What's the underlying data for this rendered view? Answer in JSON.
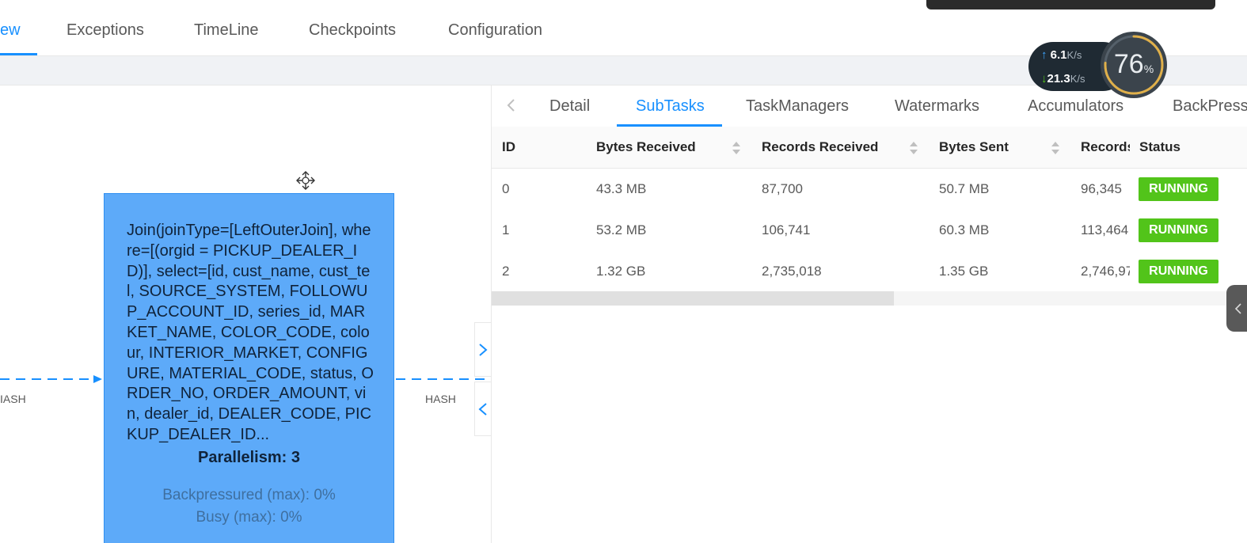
{
  "top_tabs": {
    "items": [
      {
        "label": "ew",
        "active": true
      },
      {
        "label": "Exceptions",
        "active": false
      },
      {
        "label": "TimeLine",
        "active": false
      },
      {
        "label": "Checkpoints",
        "active": false
      },
      {
        "label": "Configuration",
        "active": false
      }
    ]
  },
  "graph": {
    "node": {
      "description": "Join(joinType=[LeftOuterJoin], where=[(orgid = PICKUP_DEALER_ID)], select=[id, cust_name, cust_tel, SOURCE_SYSTEM, FOLLOWUP_ACCOUNT_ID, series_id, MARKET_NAME, COLOR_CODE, colour, INTERIOR_MARKET, CONFIGURE, MATERIAL_CODE, status, ORDER_NO, ORDER_AMOUNT, vin, dealer_id, DEALER_CODE, PICKUP_DEALER_ID...",
      "parallelism": "Parallelism: 3",
      "backpressured": "Backpressured (max): 0%",
      "busy": "Busy (max): 0%"
    },
    "edge_left_label": "IASH",
    "edge_right_label": "HASH"
  },
  "panel": {
    "tabs": [
      {
        "label": "Detail",
        "active": false
      },
      {
        "label": "SubTasks",
        "active": true
      },
      {
        "label": "TaskManagers",
        "active": false
      },
      {
        "label": "Watermarks",
        "active": false
      },
      {
        "label": "Accumulators",
        "active": false
      },
      {
        "label": "BackPress",
        "active": false
      }
    ],
    "table": {
      "columns": [
        "ID",
        "Bytes Received",
        "Records Received",
        "Bytes Sent",
        "Records",
        "Status"
      ],
      "rows": [
        {
          "id": "0",
          "bytes_received": "43.3 MB",
          "records_received": "87,700",
          "bytes_sent": "50.7 MB",
          "records_sent": "96,345",
          "status": "RUNNING"
        },
        {
          "id": "1",
          "bytes_received": "53.2 MB",
          "records_received": "106,741",
          "bytes_sent": "60.3 MB",
          "records_sent": "113,464",
          "status": "RUNNING"
        },
        {
          "id": "2",
          "bytes_received": "1.32 GB",
          "records_received": "2,735,018",
          "bytes_sent": "1.35 GB",
          "records_sent": "2,746,97",
          "status": "RUNNING"
        }
      ],
      "status_color": "#52c41a"
    }
  },
  "net_widget": {
    "up_value": "6.1",
    "down_value": "21.3",
    "unit": "K/s",
    "gauge_value": "76",
    "gauge_unit": "%",
    "gauge_fraction": 0.76
  },
  "colors": {
    "accent": "#1890ff",
    "node_fill": "#5daaf9",
    "edge": "#1890ff"
  }
}
